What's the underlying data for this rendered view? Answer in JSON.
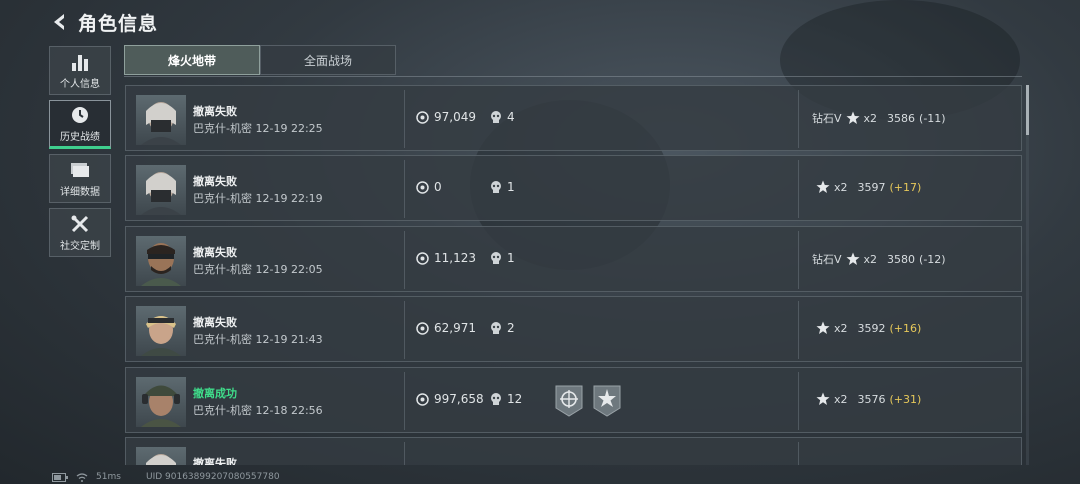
{
  "header": {
    "title": "角色信息"
  },
  "sidebar": {
    "items": [
      {
        "label": "个人信息",
        "icon": "bar-chart-icon"
      },
      {
        "label": "历史战绩",
        "icon": "clock-icon"
      },
      {
        "label": "详细数据",
        "icon": "folder-icon"
      },
      {
        "label": "社交定制",
        "icon": "tools-icon"
      }
    ]
  },
  "tabs": [
    {
      "label": "烽火地带"
    },
    {
      "label": "全面战场"
    }
  ],
  "matches": [
    {
      "result": "撤离失败",
      "map": "巴克什-机密",
      "time": "12-19 22:25",
      "money": "97,049",
      "kills": "4",
      "tier": "钻石V",
      "stars": "x2",
      "score": "3586",
      "delta": "(-11)"
    },
    {
      "result": "撤离失败",
      "map": "巴克什-机密",
      "time": "12-19 22:19",
      "money": "0",
      "kills": "1",
      "tier": "",
      "stars": "x2",
      "score": "3597",
      "delta": "(+17)"
    },
    {
      "result": "撤离失败",
      "map": "巴克什-机密",
      "time": "12-19 22:05",
      "money": "11,123",
      "kills": "1",
      "tier": "钻石V",
      "stars": "x2",
      "score": "3580",
      "delta": "(-12)"
    },
    {
      "result": "撤离失败",
      "map": "巴克什-机密",
      "time": "12-19 21:43",
      "money": "62,971",
      "kills": "2",
      "tier": "",
      "stars": "x2",
      "score": "3592",
      "delta": "(+16)"
    },
    {
      "result": "撤离成功",
      "map": "巴克什-机密",
      "time": "12-18 22:56",
      "money": "997,658",
      "kills": "12",
      "tier": "",
      "stars": "x2",
      "score": "3576",
      "delta": "(+31)"
    },
    {
      "result": "撤离失败",
      "map": "",
      "time": "",
      "money": "",
      "kills": "",
      "tier": "",
      "stars": "",
      "score": "",
      "delta": ""
    }
  ],
  "status": {
    "ping": "51ms",
    "uid": "UID 9016389920708055778​0"
  },
  "colors": {
    "success": "#3fdc8a",
    "accent": "#3fcf8e",
    "delta_positive": "#e6c85a"
  }
}
